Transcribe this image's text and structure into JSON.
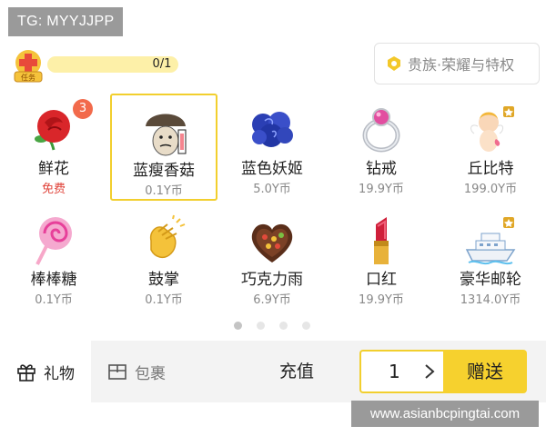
{
  "watermarks": {
    "top": "TG: MYYJJPP",
    "bottom": "www.asianbcpingtai.com"
  },
  "task": {
    "badge_icon": "task-medal-icon",
    "badge_label": "任务",
    "progress": 0.0,
    "count": "0/1"
  },
  "noble_button": {
    "icon": "noble-shield-icon",
    "label": "贵族·荣耀与特权"
  },
  "gifts": [
    {
      "name": "鲜花",
      "price": "免费",
      "icon": "rose-icon",
      "badge": "3"
    },
    {
      "name": "蓝瘦香菇",
      "price": "0.1Y币",
      "icon": "mushroom-emoji-icon",
      "selected": true
    },
    {
      "name": "蓝色妖姬",
      "price": "5.0Y币",
      "icon": "blue-rose-icon"
    },
    {
      "name": "钻戒",
      "price": "19.9Y币",
      "icon": "diamond-ring-icon"
    },
    {
      "name": "丘比特",
      "price": "199.0Y币",
      "icon": "cupid-icon"
    },
    {
      "name": "棒棒糖",
      "price": "0.1Y币",
      "icon": "lollipop-icon"
    },
    {
      "name": "鼓掌",
      "price": "0.1Y币",
      "icon": "clapping-hands-icon"
    },
    {
      "name": "巧克力雨",
      "price": "6.9Y币",
      "icon": "chocolate-box-icon"
    },
    {
      "name": "口红",
      "price": "19.9Y币",
      "icon": "lipstick-icon"
    },
    {
      "name": "豪华邮轮",
      "price": "1314.0Y币",
      "icon": "cruise-ship-icon"
    }
  ],
  "pagination": {
    "pages": 4,
    "active": 0
  },
  "bottom_bar": {
    "gift_tab": "礼物",
    "bag_tab": "包裹",
    "recharge": "充值",
    "quantity": "1",
    "send": "赠送"
  },
  "colors": {
    "accent_yellow": "#f6d12e",
    "free_red": "#e0443b",
    "badge_orange": "#f26a4b"
  }
}
